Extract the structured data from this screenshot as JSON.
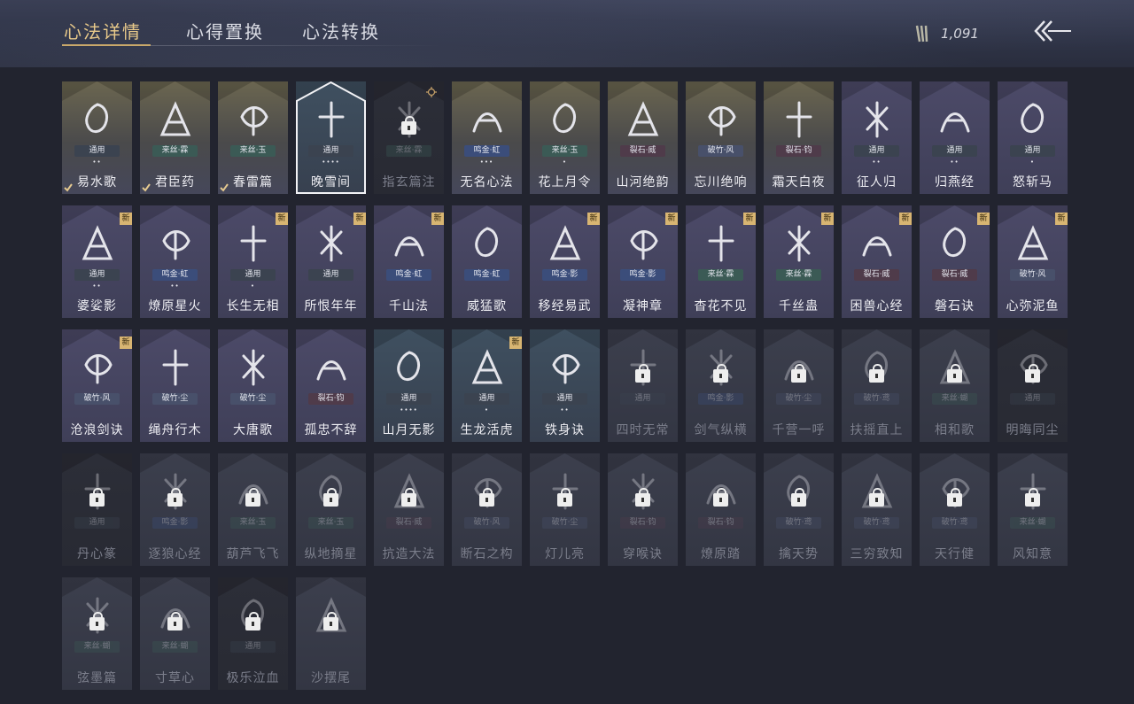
{
  "tabs": [
    {
      "label": "心法详情",
      "active": true
    },
    {
      "label": "心得置换",
      "active": false
    },
    {
      "label": "心法转换",
      "active": false
    }
  ],
  "currency": {
    "icon": "feather-icon",
    "amount": "1,091"
  },
  "colors": {
    "accent": "#e8c98a",
    "new_badge": "#d8b572"
  },
  "cards": [
    {
      "name": "易水歌",
      "tag": "通用",
      "dots": "••",
      "tone": "gold",
      "check": true
    },
    {
      "name": "君臣药",
      "tag": "来丝·霖",
      "dots": "",
      "tone": "gold",
      "check": true
    },
    {
      "name": "春雷篇",
      "tag": "来丝·玉",
      "dots": "",
      "tone": "gold",
      "check": true
    },
    {
      "name": "晚雪间",
      "tag": "通用",
      "dots": "••••",
      "tone": "teal",
      "selected": true
    },
    {
      "name": "指玄篇注",
      "tag": "来丝·霖",
      "dots": "",
      "tone": "darkc",
      "locked": true,
      "target": true
    },
    {
      "name": "无名心法",
      "tag": "鸣金·虹",
      "dots": "•••",
      "tone": "gold"
    },
    {
      "name": "花上月令",
      "tag": "来丝·玉",
      "dots": "•",
      "tone": "gold"
    },
    {
      "name": "山河绝韵",
      "tag": "裂石·威",
      "dots": "",
      "tone": "gold"
    },
    {
      "name": "忘川绝响",
      "tag": "破竹·风",
      "dots": "",
      "tone": "gold"
    },
    {
      "name": "霜天白夜",
      "tag": "裂石·钧",
      "dots": "",
      "tone": "gold"
    },
    {
      "name": "征人归",
      "tag": "通用",
      "dots": "••",
      "tone": "purple"
    },
    {
      "name": "归燕经",
      "tag": "通用",
      "dots": "••",
      "tone": "purple"
    },
    {
      "name": "怒斩马",
      "tag": "通用",
      "dots": "•",
      "tone": "purple"
    },
    {
      "name": "婆娑影",
      "tag": "通用",
      "dots": "••",
      "tone": "purple",
      "new": true
    },
    {
      "name": "燎原星火",
      "tag": "鸣金·虹",
      "dots": "••",
      "tone": "purple"
    },
    {
      "name": "长生无相",
      "tag": "通用",
      "dots": "•",
      "tone": "purple",
      "new": true
    },
    {
      "name": "所恨年年",
      "tag": "通用",
      "dots": "",
      "tone": "purple",
      "new": true
    },
    {
      "name": "千山法",
      "tag": "鸣金·虹",
      "dots": "",
      "tone": "purple",
      "new": true
    },
    {
      "name": "威猛歌",
      "tag": "鸣金·虹",
      "dots": "",
      "tone": "purple"
    },
    {
      "name": "移经易武",
      "tag": "鸣金·影",
      "dots": "",
      "tone": "purple",
      "new": true
    },
    {
      "name": "凝神章",
      "tag": "鸣金·影",
      "dots": "",
      "tone": "purple",
      "new": true
    },
    {
      "name": "杳花不见",
      "tag": "来丝·霖",
      "dots": "",
      "tone": "purple",
      "new": true
    },
    {
      "name": "千丝蛊",
      "tag": "来丝·霖",
      "dots": "",
      "tone": "purple",
      "new": true
    },
    {
      "name": "困兽心经",
      "tag": "裂石·威",
      "dots": "",
      "tone": "purple",
      "new": true
    },
    {
      "name": "磐石诀",
      "tag": "裂石·威",
      "dots": "",
      "tone": "purple",
      "new": true
    },
    {
      "name": "心弥泥鱼",
      "tag": "破竹·风",
      "dots": "",
      "tone": "purple",
      "new": true
    },
    {
      "name": "沧浪剑诀",
      "tag": "破竹·风",
      "dots": "",
      "tone": "purple",
      "new": true
    },
    {
      "name": "绳舟行木",
      "tag": "破竹·尘",
      "dots": "",
      "tone": "purple"
    },
    {
      "name": "大唐歌",
      "tag": "破竹·尘",
      "dots": "",
      "tone": "purple"
    },
    {
      "name": "孤忠不辞",
      "tag": "裂石·钧",
      "dots": "",
      "tone": "purple"
    },
    {
      "name": "山月无影",
      "tag": "通用",
      "dots": "••••",
      "tone": "teal"
    },
    {
      "name": "生龙活虎",
      "tag": "通用",
      "dots": "•",
      "tone": "teal",
      "new": true
    },
    {
      "name": "铁身诀",
      "tag": "通用",
      "dots": "••",
      "tone": "teal"
    },
    {
      "name": "四时无常",
      "tag": "通用",
      "dots": "",
      "tone": "dim",
      "locked": true
    },
    {
      "name": "剑气纵横",
      "tag": "鸣金·影",
      "dots": "",
      "tone": "dim",
      "locked": true
    },
    {
      "name": "千营一呼",
      "tag": "破竹·尘",
      "dots": "",
      "tone": "dim",
      "locked": true
    },
    {
      "name": "扶摇直上",
      "tag": "破竹·鸢",
      "dots": "",
      "tone": "dim",
      "locked": true
    },
    {
      "name": "相和歌",
      "tag": "来丝·蝴",
      "dots": "",
      "tone": "dim",
      "locked": true
    },
    {
      "name": "明晦同尘",
      "tag": "通用",
      "dots": "",
      "tone": "darkc",
      "locked": true
    },
    {
      "name": "丹心篆",
      "tag": "通用",
      "dots": "",
      "tone": "darkc",
      "locked": true
    },
    {
      "name": "逐狼心经",
      "tag": "鸣金·影",
      "dots": "",
      "tone": "dim",
      "locked": true
    },
    {
      "name": "葫芦飞飞",
      "tag": "来丝·玉",
      "dots": "",
      "tone": "dim",
      "locked": true
    },
    {
      "name": "纵地摘星",
      "tag": "来丝·玉",
      "dots": "",
      "tone": "dim",
      "locked": true
    },
    {
      "name": "抗造大法",
      "tag": "裂石·威",
      "dots": "",
      "tone": "dim",
      "locked": true
    },
    {
      "name": "断石之构",
      "tag": "破竹·风",
      "dots": "",
      "tone": "dim",
      "locked": true
    },
    {
      "name": "灯儿亮",
      "tag": "破竹·尘",
      "dots": "",
      "tone": "dim",
      "locked": true
    },
    {
      "name": "穿喉诀",
      "tag": "裂石·钧",
      "dots": "",
      "tone": "dim",
      "locked": true
    },
    {
      "name": "燎原踏",
      "tag": "裂石·钧",
      "dots": "",
      "tone": "dim",
      "locked": true
    },
    {
      "name": "擒天势",
      "tag": "破竹·鸢",
      "dots": "",
      "tone": "dim",
      "locked": true
    },
    {
      "name": "三穷致知",
      "tag": "破竹·鸢",
      "dots": "",
      "tone": "dim",
      "locked": true
    },
    {
      "name": "天行健",
      "tag": "破竹·鸢",
      "dots": "",
      "tone": "dim",
      "locked": true
    },
    {
      "name": "风知意",
      "tag": "来丝·蝴",
      "dots": "",
      "tone": "dim",
      "locked": true
    },
    {
      "name": "弦墨篇",
      "tag": "来丝·蝴",
      "dots": "",
      "tone": "dim",
      "locked": true
    },
    {
      "name": "寸草心",
      "tag": "来丝·蝴",
      "dots": "",
      "tone": "dim",
      "locked": true
    },
    {
      "name": "极乐泣血",
      "tag": "通用",
      "dots": "",
      "tone": "darkc",
      "locked": true
    },
    {
      "name": "沙摆尾",
      "tag": "",
      "dots": "",
      "tone": "dim",
      "locked": true
    }
  ]
}
